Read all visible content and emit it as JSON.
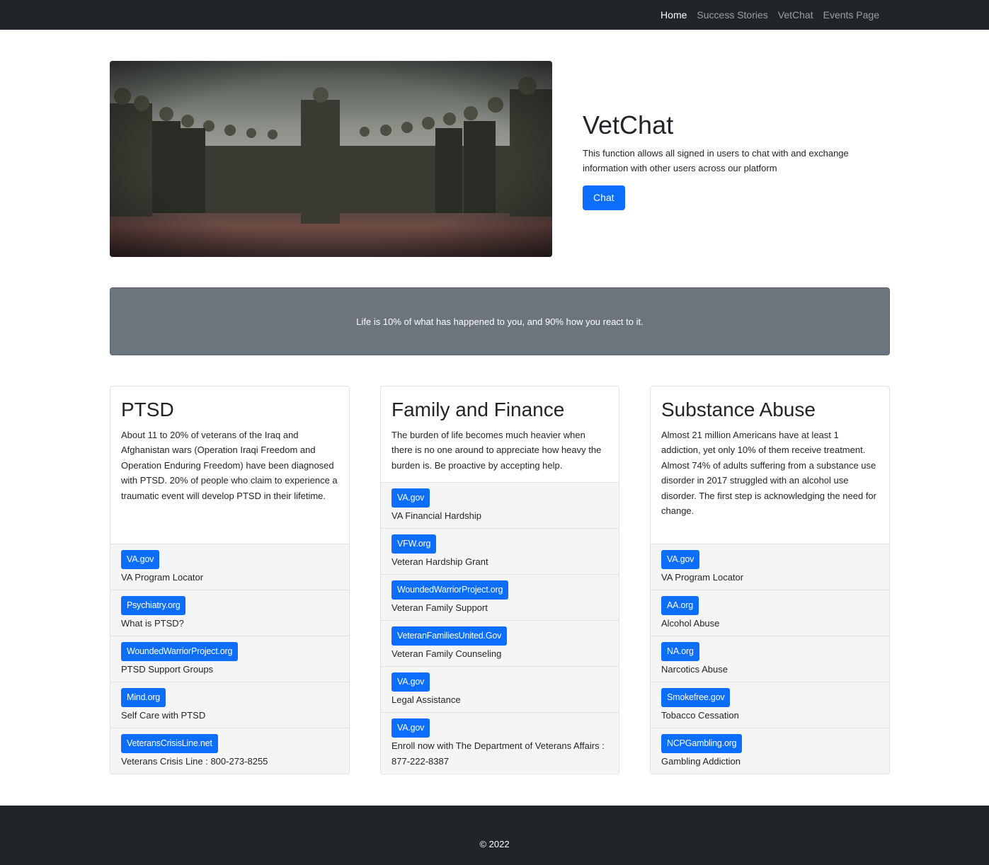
{
  "nav": {
    "items": [
      {
        "label": "Home",
        "active": true
      },
      {
        "label": "Success Stories",
        "active": false
      },
      {
        "label": "VetChat",
        "active": false
      },
      {
        "label": "Events Page",
        "active": false
      }
    ]
  },
  "hero": {
    "image_icon": "soldiers-photo",
    "title": "VetChat",
    "description": "This function allows all signed in users to chat with and exchange information with other users across our platform",
    "button_label": "Chat"
  },
  "quote": {
    "text": "Life is 10% of what has happened to you, and 90% how you react to it."
  },
  "cards": [
    {
      "title": "PTSD",
      "text": "About 11 to 20% of veterans of the Iraq and Afghanistan wars (Operation Iraqi Freedom and Operation Enduring Freedom) have been diagnosed with PTSD. 20% of people who claim to experience a traumatic event will develop PTSD in their lifetime.",
      "links": [
        {
          "badge": "VA.gov",
          "desc": "VA Program Locator"
        },
        {
          "badge": "Psychiatry.org",
          "desc": "What is PTSD?"
        },
        {
          "badge": "WoundedWarriorProject.org",
          "desc": "PTSD Support Groups"
        },
        {
          "badge": "Mind.org",
          "desc": "Self Care with PTSD"
        },
        {
          "badge": "VeteransCrisisLine.net",
          "desc": "Veterans Crisis Line : 800-273-8255"
        }
      ]
    },
    {
      "title": "Family and Finance",
      "text": "The burden of life becomes much heavier when there is no one around to appreciate how heavy the burden is. Be proactive by accepting help.",
      "links": [
        {
          "badge": "VA.gov",
          "desc": "VA Financial Hardship"
        },
        {
          "badge": "VFW.org",
          "desc": "Veteran Hardship Grant"
        },
        {
          "badge": "WoundedWarriorProject.org",
          "desc": "Veteran Family Support"
        },
        {
          "badge": "VeteranFamiliesUnited.Gov",
          "desc": "Veteran Family Counseling"
        },
        {
          "badge": "VA.gov",
          "desc": "Legal Assistance"
        },
        {
          "badge": "VA.gov",
          "desc": "Enroll now with The Department of Veterans Affairs : 877-222-8387"
        }
      ]
    },
    {
      "title": "Substance Abuse",
      "text": "Almost 21 million Americans have at least 1 addiction, yet only 10% of them receive treatment. Almost 74% of adults suffering from a substance use disorder in 2017 struggled with an alcohol use disorder. The first step is acknowledging the need for change.",
      "links": [
        {
          "badge": "VA.gov",
          "desc": "VA Program Locator"
        },
        {
          "badge": "AA.org",
          "desc": "Alcohol Abuse"
        },
        {
          "badge": "NA.org",
          "desc": "Narcotics Abuse"
        },
        {
          "badge": "Smokefree.gov",
          "desc": "Tobacco Cessation"
        },
        {
          "badge": "NCPGambling.org",
          "desc": "Gambling Addiction"
        }
      ]
    }
  ],
  "footer": {
    "text": "© 2022"
  }
}
